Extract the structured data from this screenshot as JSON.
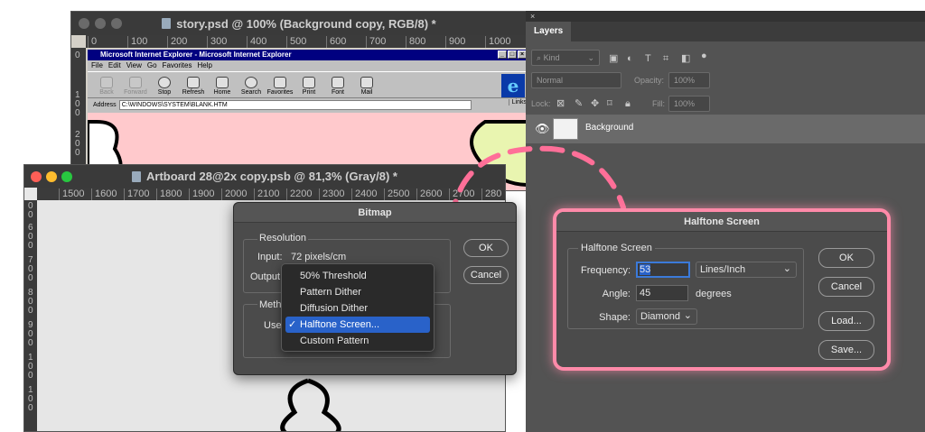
{
  "window1": {
    "title": "story.psd @ 100% (Background copy, RGB/8) *",
    "ruler_labels": [
      "0",
      "100",
      "200",
      "300",
      "400",
      "500",
      "600",
      "700",
      "800",
      "900",
      "1000"
    ],
    "ruler_v_labels": [
      "0",
      "1",
      "0",
      "0",
      "2",
      "0",
      "0"
    ]
  },
  "ie": {
    "title": "Microsoft Internet Explorer - Microsoft Internet Explorer",
    "menu": [
      "File",
      "Edit",
      "View",
      "Go",
      "Favorites",
      "Help"
    ],
    "toolbar": [
      "Back",
      "Forward",
      "Stop",
      "Refresh",
      "Home",
      "Search",
      "Favorites",
      "Print",
      "Font",
      "Mail"
    ],
    "address_label": "Address",
    "address_value": "C:\\WINDOWS\\SYSTEM\\BLANK.HTM",
    "links_label": "Links"
  },
  "window2": {
    "title": "Artboard 28@2x copy.psb @ 81,3% (Gray/8) *",
    "ruler_labels": [
      "1500",
      "1600",
      "1700",
      "1800",
      "1900",
      "2000",
      "2100",
      "2200",
      "2300",
      "2400",
      "2500",
      "2600",
      "2700",
      "280"
    ],
    "ruler_v_labels": [
      "0",
      "0",
      "6",
      "0",
      "0",
      "7",
      "0",
      "0",
      "8",
      "0",
      "0",
      "9",
      "0",
      "0",
      "1",
      "0",
      "0",
      "1",
      "0",
      "0"
    ]
  },
  "layers_panel": {
    "tab_label": "Layers",
    "kind_label": "Kind",
    "blend_mode": "Normal",
    "opacity_label": "Opacity:",
    "opacity_value": "100%",
    "lock_label": "Lock:",
    "fill_label": "Fill:",
    "fill_value": "100%",
    "layer_name": "Background"
  },
  "bitmap_dialog": {
    "title": "Bitmap",
    "resolution_label": "Resolution",
    "input_label": "Input:",
    "input_value": "72 pixels/cm",
    "output_label": "Output",
    "method_label": "Meth",
    "use_label": "Use",
    "ok_label": "OK",
    "cancel_label": "Cancel",
    "method_options": [
      "50% Threshold",
      "Pattern Dither",
      "Diffusion Dither",
      "Halftone Screen...",
      "Custom Pattern"
    ],
    "selected_method": "Halftone Screen..."
  },
  "halftone_dialog": {
    "title": "Halftone Screen",
    "group_label": "Halftone Screen",
    "frequency_label": "Frequency:",
    "frequency_value": "53",
    "frequency_unit": "Lines/Inch",
    "angle_label": "Angle:",
    "angle_value": "45",
    "angle_unit": "degrees",
    "shape_label": "Shape:",
    "shape_value": "Diamond",
    "ok_label": "OK",
    "cancel_label": "Cancel",
    "load_label": "Load...",
    "save_label": "Save...",
    "highlight_color": "#ff8aa9"
  }
}
